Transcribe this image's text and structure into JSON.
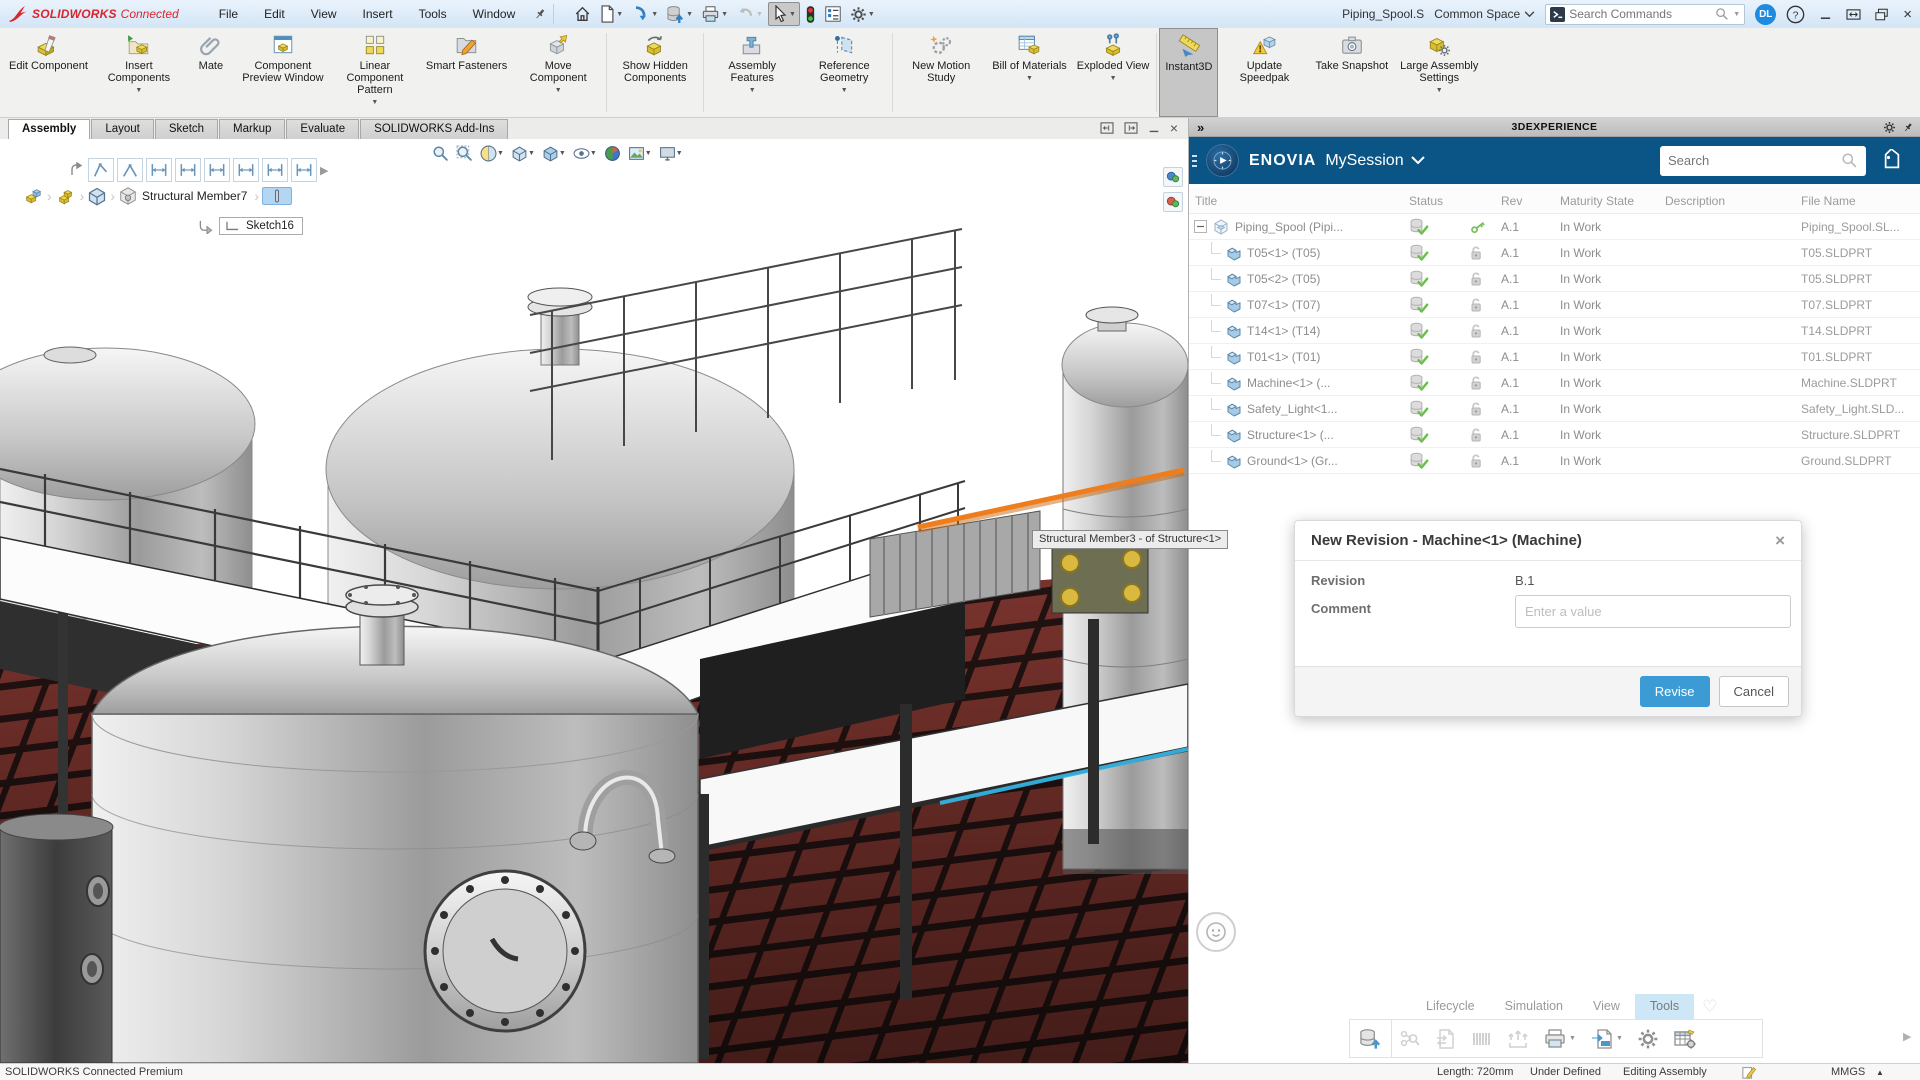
{
  "titlebar": {
    "brand_bold": "SOLIDWORKS",
    "brand_rest": "Connected",
    "menus": [
      "File",
      "Edit",
      "View",
      "Insert",
      "Tools",
      "Window"
    ],
    "doc": "Piping_Spool.S",
    "space": "Common Space",
    "search_placeholder": "Search Commands",
    "avatar": "DL"
  },
  "ribbon": {
    "buttons": [
      {
        "label": "Edit Component"
      },
      {
        "label": "Insert Components",
        "dd": true
      },
      {
        "label": "Mate"
      },
      {
        "label": "Component Preview Window"
      },
      {
        "label": "Linear Component Pattern",
        "dd": true
      },
      {
        "label": "Smart Fasteners"
      },
      {
        "label": "Move Component",
        "dd": true
      },
      {
        "label": "Show Hidden Components"
      },
      {
        "label": "Assembly Features",
        "dd": true
      },
      {
        "label": "Reference Geometry",
        "dd": true
      },
      {
        "label": "New Motion Study"
      },
      {
        "label": "Bill of Materials",
        "dd": true
      },
      {
        "label": "Exploded View",
        "dd": true
      },
      {
        "label": "Instant3D",
        "active": true
      },
      {
        "label": "Update Speedpak"
      },
      {
        "label": "Take Snapshot"
      },
      {
        "label": "Large Assembly Settings",
        "dd": true
      }
    ]
  },
  "tabs": {
    "items": [
      "Assembly",
      "Layout",
      "Sketch",
      "Markup",
      "Evaluate",
      "SOLIDWORKS Add-Ins"
    ],
    "active": "Assembly"
  },
  "viewport": {
    "breadcrumb_label": "Structural Member7",
    "sketch_label": "Sketch16",
    "tooltip": "Structural Member3 -  of Structure<1>"
  },
  "panel": {
    "title": "3DEXPERIENCE",
    "brand": "ENOVIA",
    "session": "MySession",
    "search_placeholder": "Search",
    "columns": {
      "title": "Title",
      "status": "Status",
      "rev": "Rev",
      "maturity": "Maturity State",
      "description": "Description",
      "file": "File Name"
    },
    "rows": [
      {
        "title": "Piping_Spool (Pipi...",
        "rev": "A.1",
        "maturity": "In Work",
        "file": "Piping_Spool.SL..."
      },
      {
        "title": "T05<1> (T05)",
        "rev": "A.1",
        "maturity": "In Work",
        "file": "T05.SLDPRT"
      },
      {
        "title": "T05<2> (T05)",
        "rev": "A.1",
        "maturity": "In Work",
        "file": "T05.SLDPRT"
      },
      {
        "title": "T07<1> (T07)",
        "rev": "A.1",
        "maturity": "In Work",
        "file": "T07.SLDPRT"
      },
      {
        "title": "T14<1> (T14)",
        "rev": "A.1",
        "maturity": "In Work",
        "file": "T14.SLDPRT"
      },
      {
        "title": "T01<1> (T01)",
        "rev": "A.1",
        "maturity": "In Work",
        "file": "T01.SLDPRT"
      },
      {
        "title": "Machine<1> (...",
        "rev": "A.1",
        "maturity": "In Work",
        "file": "Machine.SLDPRT"
      },
      {
        "title": "Safety_Light<1...",
        "rev": "A.1",
        "maturity": "In Work",
        "file": "Safety_Light.SLD..."
      },
      {
        "title": "Structure<1> (...",
        "rev": "A.1",
        "maturity": "In Work",
        "file": "Structure.SLDPRT"
      },
      {
        "title": "Ground<1> (Gr...",
        "rev": "A.1",
        "maturity": "In Work",
        "file": "Ground.SLDPRT"
      }
    ],
    "bottom_tabs": {
      "items": [
        "Lifecycle",
        "Simulation",
        "View",
        "Tools"
      ],
      "active": "Tools"
    }
  },
  "dialog": {
    "title": "New Revision - Machine<1> (Machine)",
    "revision_label": "Revision",
    "revision_value": "B.1",
    "comment_label": "Comment",
    "comment_placeholder": "Enter a value",
    "revise_label": "Revise",
    "cancel_label": "Cancel"
  },
  "statusbar": {
    "left": "SOLIDWORKS Connected Premium",
    "length": "Length: 720mm",
    "constraint": "Under Defined",
    "mode": "Editing Assembly",
    "units": "MMGS"
  },
  "colors": {
    "accent_blue": "#3c9bd5",
    "enovia_blue": "#0a5486",
    "solidworks_red": "#d8262c",
    "highlight_orange": "#ee7d1e",
    "status_green": "#6abf4b"
  }
}
